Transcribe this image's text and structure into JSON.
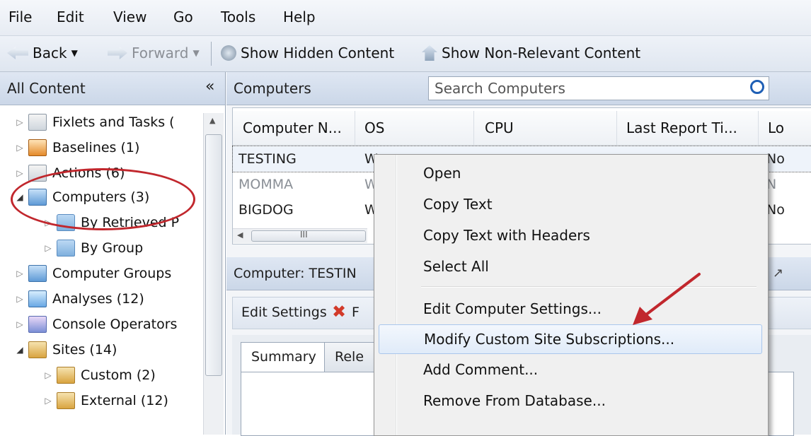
{
  "menubar": {
    "items": [
      "File",
      "Edit",
      "View",
      "Go",
      "Tools",
      "Help"
    ]
  },
  "toolbar": {
    "back": "Back",
    "forward": "Forward",
    "show_hidden": "Show Hidden Content",
    "show_non_relevant": "Show Non-Relevant Content"
  },
  "left_panel": {
    "header": "All Content",
    "collapse_glyph": "«",
    "tree": [
      {
        "label": "Fixlets and Tasks (",
        "icon": "list-icon"
      },
      {
        "label": "Baselines (1)",
        "icon": "baseline-icon"
      },
      {
        "label": "Actions (6)",
        "icon": "action-icon"
      },
      {
        "label": "Computers (3)",
        "icon": "computer-icon"
      },
      {
        "label": "By Retrieved P",
        "icon": "folder-icon"
      },
      {
        "label": "By Group",
        "icon": "folder-icon"
      },
      {
        "label": "Computer Groups",
        "icon": "computer-group-icon"
      },
      {
        "label": "Analyses (12)",
        "icon": "analysis-icon"
      },
      {
        "label": "Console Operators",
        "icon": "operators-icon"
      },
      {
        "label": "Sites (14)",
        "icon": "site-icon"
      },
      {
        "label": "Custom (2)",
        "icon": "site-icon"
      },
      {
        "label": "External (12)",
        "icon": "site-icon"
      }
    ]
  },
  "computers_pane": {
    "title": "Computers",
    "search_placeholder": "Search Computers",
    "columns": [
      "Computer N...",
      "OS",
      "CPU",
      "Last Report Ti...",
      "Lo"
    ],
    "rows": [
      {
        "name": "TESTING",
        "os": "W",
        "lock": "No"
      },
      {
        "name": "MOMMA",
        "os": "W",
        "lock": "N"
      },
      {
        "name": "BIGDOG",
        "os": "W",
        "lock": "No"
      }
    ],
    "scroll_glyph": "III"
  },
  "detail_pane": {
    "title": "Computer: TESTIN",
    "edit_settings": "Edit Settings",
    "edit_extra": "F",
    "tabs": [
      "Summary",
      "Rele"
    ]
  },
  "context_menu": {
    "items": [
      "Open",
      "Copy Text",
      "Copy Text with Headers",
      "Select All",
      "Edit Computer Settings...",
      "Modify Custom Site Subscriptions...",
      "Add Comment...",
      "Remove From Database..."
    ],
    "highlighted": "Modify Custom Site Subscriptions..."
  },
  "annotation_color": "#c1272d"
}
